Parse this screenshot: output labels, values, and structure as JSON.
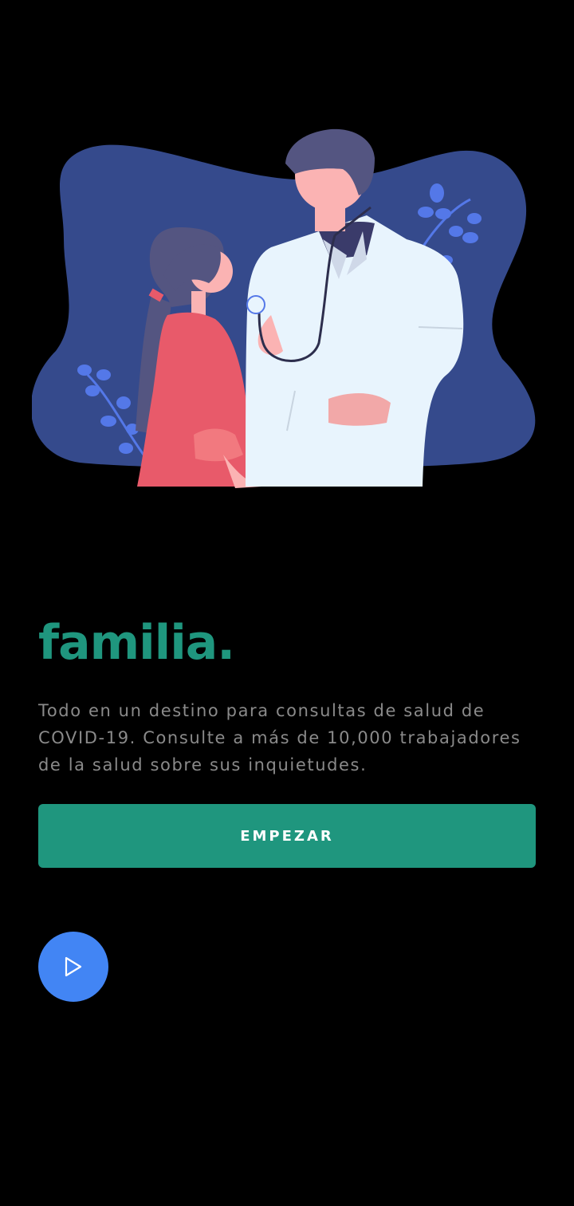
{
  "hero": {
    "illustration": "doctor-with-stethoscope-examining-girl-illustration"
  },
  "headline": "familia.",
  "description": "Todo en un destino para consultas de salud de COVID-19. Consulte a más de 10,000 trabajadores de la salud sobre sus inquietudes.",
  "cta": {
    "label": "EMPEZAR"
  },
  "fab": {
    "icon": "play-icon"
  },
  "colors": {
    "background": "#000000",
    "accent": "#1f967e",
    "description_text": "#8a8a8a",
    "fab": "#4285f4",
    "blob": "#354a8c",
    "doctor_coat": "#e8f4fd",
    "girl_shirt": "#e85a6a",
    "hair": "#545581",
    "skin": "#fbb3b3"
  }
}
